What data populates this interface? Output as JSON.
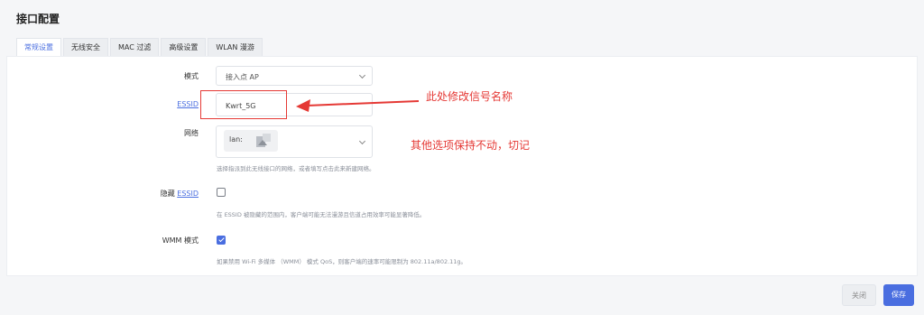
{
  "section_title": "接口配置",
  "tabs": [
    {
      "label": "常规设置"
    },
    {
      "label": "无线安全"
    },
    {
      "label": "MAC 过滤"
    },
    {
      "label": "高级设置"
    },
    {
      "label": "WLAN 漫游"
    }
  ],
  "form": {
    "mode_label": "模式",
    "mode_value": "接入点 AP",
    "essid_label": "ESSID",
    "essid_value": "Kwrt_5G",
    "network_label": "网络",
    "network_tag": "lan:",
    "network_hint": "选择指派到此无线接口的网络，或者填写点击此来新建网络。",
    "hidden_label": "隐藏",
    "hidden_essid_link": "ESSID",
    "hidden_hint": "在 ESSID 被隐藏的范围内，客户端可能无法漫游且信道占用效率可能显著降低。",
    "wmm_label": "WMM 模式",
    "wmm_hint": "如果禁用 Wi-Fi 多媒体 （WMM） 模式 QoS，则客户端的速率可能限制为 802.11a/802.11g。",
    "hidden_checked": false,
    "wmm_checked": true
  },
  "annotations": {
    "essid_note": "此处修改信号名称",
    "keep_note": "其他选项保持不动，切记"
  },
  "buttons": {
    "close": "关闭",
    "save": "保存"
  },
  "colors": {
    "accent": "#4a6ee0",
    "annotation": "#e53935"
  }
}
